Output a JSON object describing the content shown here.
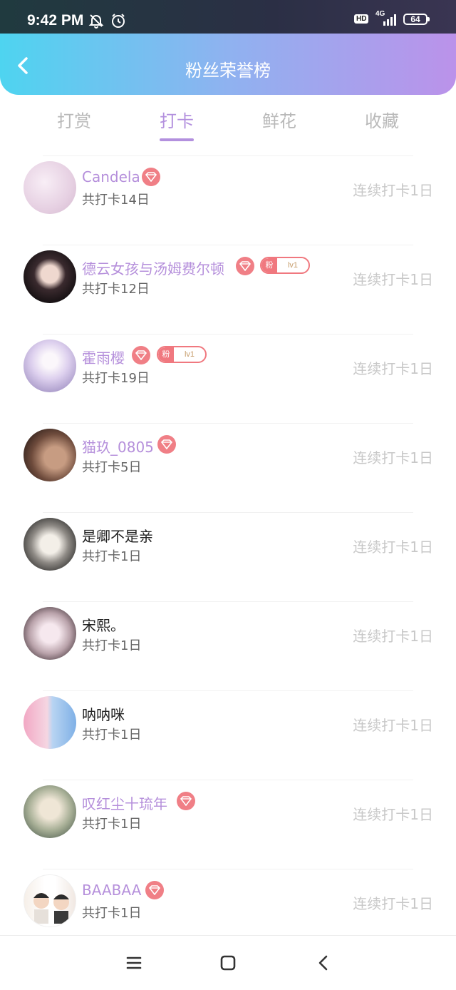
{
  "status_bar": {
    "time": "9:42 PM",
    "hd": "HD",
    "network": "4G",
    "battery": "64"
  },
  "header": {
    "title": "粉丝荣誉榜"
  },
  "tabs": [
    {
      "label": "打赏",
      "active": false
    },
    {
      "label": "打卡",
      "active": true
    },
    {
      "label": "鲜花",
      "active": false
    },
    {
      "label": "收藏",
      "active": false
    }
  ],
  "fans": [
    {
      "name": "Candela",
      "vip": true,
      "fan_badge": null,
      "total": "共打卡14日",
      "streak": "连续打卡1日"
    },
    {
      "name": "德云女孩与汤姆费尔顿",
      "vip": true,
      "fan_badge": {
        "label": "粉",
        "level": "lv1"
      },
      "total": "共打卡12日",
      "streak": "连续打卡1日"
    },
    {
      "name": "霍雨樱",
      "vip": true,
      "fan_badge": {
        "label": "粉",
        "level": "lv1"
      },
      "total": "共打卡19日",
      "streak": "连续打卡1日"
    },
    {
      "name": "猫玖_0805",
      "vip": true,
      "fan_badge": null,
      "total": "共打卡5日",
      "streak": "连续打卡1日"
    },
    {
      "name": "是卿不是亲",
      "vip": false,
      "fan_badge": null,
      "total": "共打卡1日",
      "streak": "连续打卡1日"
    },
    {
      "name": "宋熙。",
      "vip": false,
      "fan_badge": null,
      "total": "共打卡1日",
      "streak": "连续打卡1日"
    },
    {
      "name": "呐呐咪",
      "vip": false,
      "fan_badge": null,
      "total": "共打卡1日",
      "streak": "连续打卡1日"
    },
    {
      "name": "叹红尘十琉年",
      "vip": true,
      "fan_badge": null,
      "total": "共打卡1日",
      "streak": "连续打卡1日"
    },
    {
      "name": "BAABAA",
      "vip": true,
      "fan_badge": null,
      "total": "共打卡1日",
      "streak": "连续打卡1日"
    }
  ],
  "colors": {
    "accent": "#b390de",
    "vip_badge": "#f07f86",
    "inactive_text": "#b9b9b9"
  },
  "icons": {
    "back": "chevron-left-icon",
    "vip": "diamond-icon",
    "nav": [
      "menu-icon",
      "home-square-icon",
      "back-triangle-icon"
    ]
  }
}
